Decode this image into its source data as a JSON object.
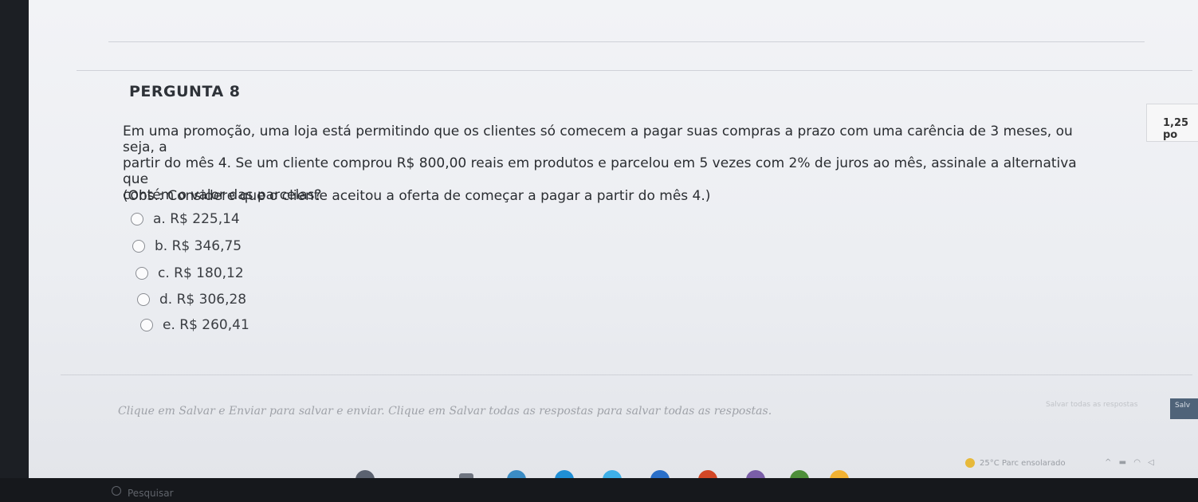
{
  "question": {
    "header": "PERGUNTA 8",
    "points": "1,25 po",
    "text_main": "Em uma promoção, uma loja está permitindo que os clientes só comecem a pagar suas compras a prazo com uma carência de 3 meses, ou seja, a",
    "text_line2": "partir do mês 4. Se um cliente comprou R$ 800,00 reais em produtos e parcelou em 5 vezes com 2% de juros ao mês, assinale a alternativa que",
    "text_line3": "contém o valor das parcelas?",
    "obs": "(Obs.: Considere que o cliente aceitou a oferta de começar a pagar a partir do mês 4.)",
    "options": [
      {
        "label": "a. R$ 225,14"
      },
      {
        "label": "b. R$ 346,75"
      },
      {
        "label": "c. R$ 180,12"
      },
      {
        "label": "d. R$ 306,28"
      },
      {
        "label": "e. R$ 260,41"
      }
    ]
  },
  "footer": {
    "hint": "Clique em Salvar e Enviar para salvar e enviar. Clique em Salvar todas as respostas para salvar todas as respostas.",
    "save_all": "Salvar todas as respostas",
    "submit": "Salv"
  },
  "taskbar": {
    "search": "Pesquisar",
    "weather": "25°C  Parc ensolarado",
    "icon_colors": {
      "edge": "#1f8fd6",
      "outlook": "#2a6fc9",
      "office": "#d24726",
      "chrome": "#f2b233"
    }
  }
}
